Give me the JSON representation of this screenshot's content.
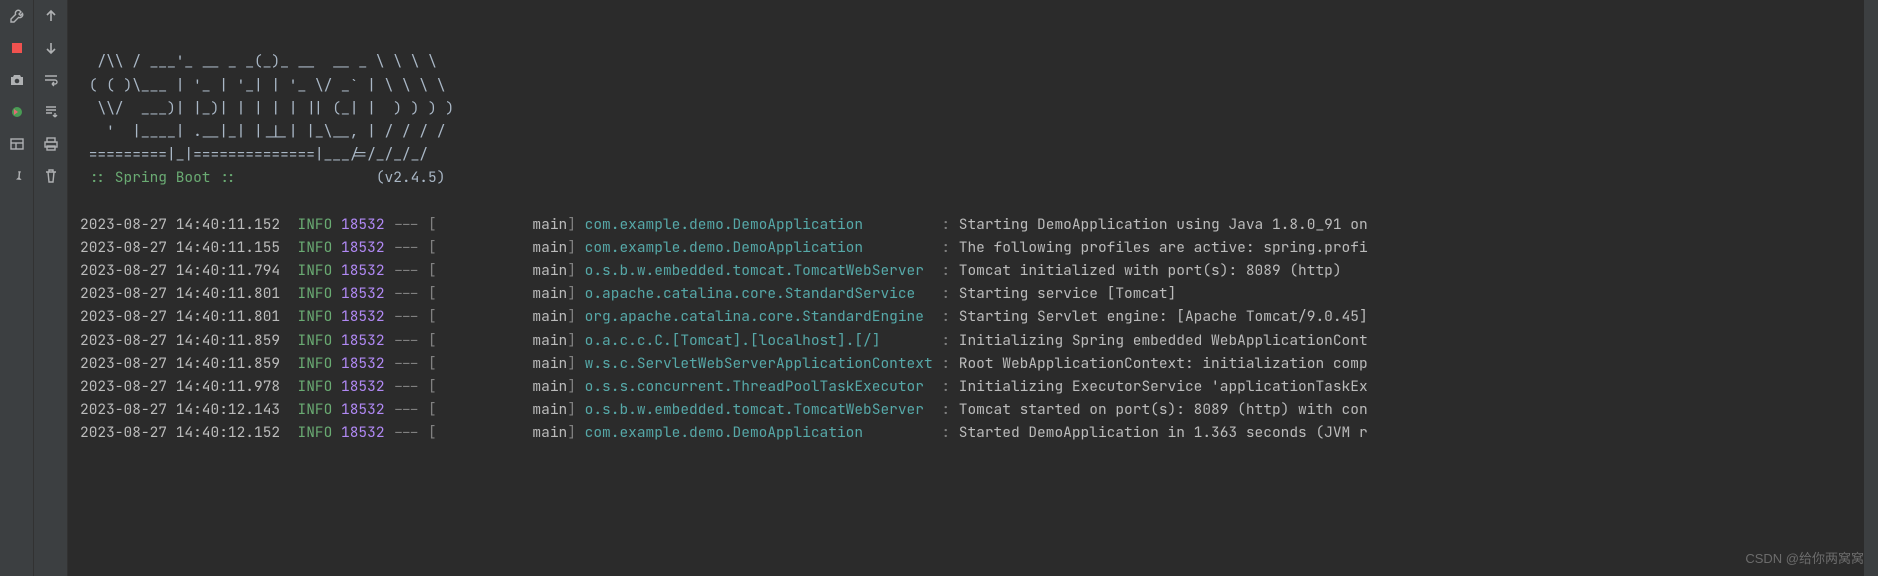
{
  "banner": {
    "lines": [
      "  /\\\\ / ___'_ __ _ _(_)_ __  __ _ \\ \\ \\ \\",
      " ( ( )\\___ | '_ | '_| | '_ \\/ _` | \\ \\ \\ \\",
      "  \\\\/  ___)| |_)| | | | | || (_| |  ) ) ) )",
      "   '  |____| .__|_| |_|_| |_\\__, | / / / /",
      " =========|_|==============|___/=/_/_/_/"
    ],
    "tag": " :: Spring Boot ::",
    "version": "(v2.4.5)"
  },
  "log_rows": [
    {
      "ts": "2023-08-27 14:40:11.152",
      "lvl": "INFO",
      "pid": "18532",
      "thr": "main",
      "logger": "com.example.demo.DemoApplication",
      "msg": "Starting DemoApplication using Java 1.8.0_91 on"
    },
    {
      "ts": "2023-08-27 14:40:11.155",
      "lvl": "INFO",
      "pid": "18532",
      "thr": "main",
      "logger": "com.example.demo.DemoApplication",
      "msg": "The following profiles are active: spring.profi"
    },
    {
      "ts": "2023-08-27 14:40:11.794",
      "lvl": "INFO",
      "pid": "18532",
      "thr": "main",
      "logger": "o.s.b.w.embedded.tomcat.TomcatWebServer",
      "msg": "Tomcat initialized with port(s): 8089 (http)"
    },
    {
      "ts": "2023-08-27 14:40:11.801",
      "lvl": "INFO",
      "pid": "18532",
      "thr": "main",
      "logger": "o.apache.catalina.core.StandardService",
      "msg": "Starting service [Tomcat]"
    },
    {
      "ts": "2023-08-27 14:40:11.801",
      "lvl": "INFO",
      "pid": "18532",
      "thr": "main",
      "logger": "org.apache.catalina.core.StandardEngine",
      "msg": "Starting Servlet engine: [Apache Tomcat/9.0.45]"
    },
    {
      "ts": "2023-08-27 14:40:11.859",
      "lvl": "INFO",
      "pid": "18532",
      "thr": "main",
      "logger": "o.a.c.c.C.[Tomcat].[localhost].[/]",
      "msg": "Initializing Spring embedded WebApplicationCont"
    },
    {
      "ts": "2023-08-27 14:40:11.859",
      "lvl": "INFO",
      "pid": "18532",
      "thr": "main",
      "logger": "w.s.c.ServletWebServerApplicationContext",
      "msg": "Root WebApplicationContext: initialization comp"
    },
    {
      "ts": "2023-08-27 14:40:11.978",
      "lvl": "INFO",
      "pid": "18532",
      "thr": "main",
      "logger": "o.s.s.concurrent.ThreadPoolTaskExecutor",
      "msg": "Initializing ExecutorService 'applicationTaskEx"
    },
    {
      "ts": "2023-08-27 14:40:12.143",
      "lvl": "INFO",
      "pid": "18532",
      "thr": "main",
      "logger": "o.s.b.w.embedded.tomcat.TomcatWebServer",
      "msg": "Tomcat started on port(s): 8089 (http) with con"
    },
    {
      "ts": "2023-08-27 14:40:12.152",
      "lvl": "INFO",
      "pid": "18532",
      "thr": "main",
      "logger": "com.example.demo.DemoApplication",
      "msg": "Started DemoApplication in 1.363 seconds (JVM r"
    }
  ],
  "watermark": "CSDN @给你两窝窝"
}
